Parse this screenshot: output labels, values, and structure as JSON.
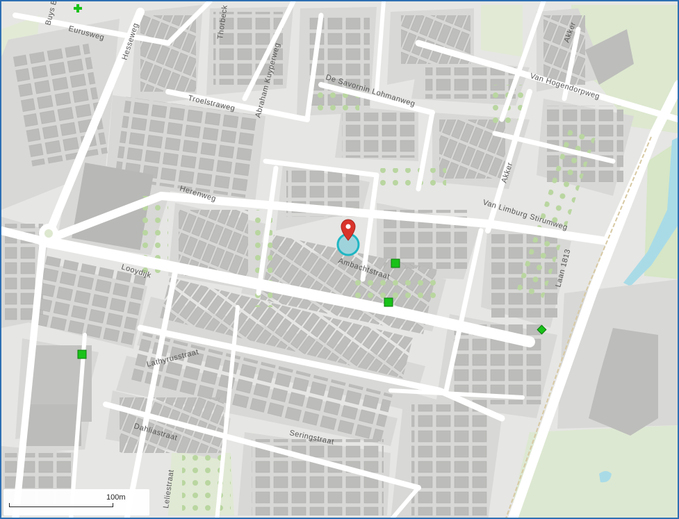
{
  "map": {
    "streets": [
      {
        "id": "buys",
        "name": "Buys B"
      },
      {
        "id": "eurusweg",
        "name": "Eurusweg"
      },
      {
        "id": "hesseweg",
        "name": "Hesseweg"
      },
      {
        "id": "thorbeck",
        "name": "Thorbeck"
      },
      {
        "id": "abraham",
        "name": "Abraham Kuyperweg"
      },
      {
        "id": "desavornin",
        "name": "De Savornin Lohmanweg"
      },
      {
        "id": "vanhogendorp",
        "name": "Van Hogendorpweg"
      },
      {
        "id": "akker1",
        "name": "Akker"
      },
      {
        "id": "akker2",
        "name": "Akker"
      },
      {
        "id": "troelstraweg",
        "name": "Troelstraweg"
      },
      {
        "id": "herenweg",
        "name": "Herenweg"
      },
      {
        "id": "vanlimburg",
        "name": "Van Limburg Stirumweg"
      },
      {
        "id": "laan1813",
        "name": "Laan 1813"
      },
      {
        "id": "ambachtstraat",
        "name": "Ambachtstraat"
      },
      {
        "id": "looydijk",
        "name": "Looydijk"
      },
      {
        "id": "lathyrusstraat",
        "name": "Lathyrusstraat"
      },
      {
        "id": "dahliastraat",
        "name": "Dahliastraat"
      },
      {
        "id": "seringstraat",
        "name": "Seringstraat"
      },
      {
        "id": "leliestraat",
        "name": "Leliestraat"
      }
    ],
    "scalebar_label": "100m",
    "colors": {
      "road": "#ffffff",
      "block": "#d4d4d2",
      "building": "#bdbdbb",
      "park": "#dfe8d2",
      "water": "#a8dbe6",
      "tree": "#b7d39e",
      "poi_green": "#19c219",
      "pin_red": "#d9342b",
      "selection_ring": "#1fb6c3"
    },
    "markers": [
      {
        "id": "pin-ambachtstraat",
        "type": "location-pin"
      },
      {
        "id": "poi-1",
        "type": "green-square"
      },
      {
        "id": "poi-2",
        "type": "green-square"
      },
      {
        "id": "poi-3",
        "type": "green-square"
      },
      {
        "id": "poi-4",
        "type": "green-diamond"
      },
      {
        "id": "poi-5",
        "type": "green-cross"
      }
    ]
  }
}
